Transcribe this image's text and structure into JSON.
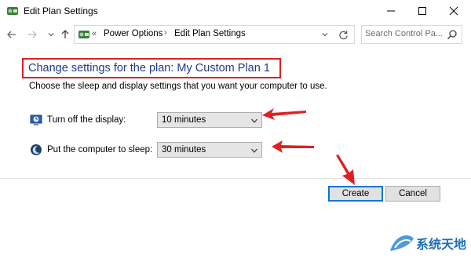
{
  "window": {
    "title": "Edit Plan Settings",
    "controls": {
      "minimize": "minimize",
      "maximize": "maximize",
      "close": "close"
    }
  },
  "nav": {
    "breadcrumb_prefix": "«",
    "breadcrumb": [
      "Power Options",
      "Edit Plan Settings"
    ],
    "separator": "›",
    "search_placeholder": "Search Control Pa..."
  },
  "main": {
    "title": "Change settings for the plan: My Custom Plan 1",
    "description": "Choose the sleep and display settings that you want your computer to use.",
    "settings": [
      {
        "label": "Turn off the display:",
        "value": "10 minutes",
        "icon": "display-icon"
      },
      {
        "label": "Put the computer to sleep:",
        "value": "30 minutes",
        "icon": "sleep-moon-icon"
      }
    ]
  },
  "buttons": {
    "create": "Create",
    "cancel": "Cancel"
  },
  "watermark": {
    "text": "系统天地"
  },
  "colors": {
    "highlight_red": "#e02020",
    "title_blue": "#1e3a8a",
    "primary_border": "#0078d7"
  }
}
